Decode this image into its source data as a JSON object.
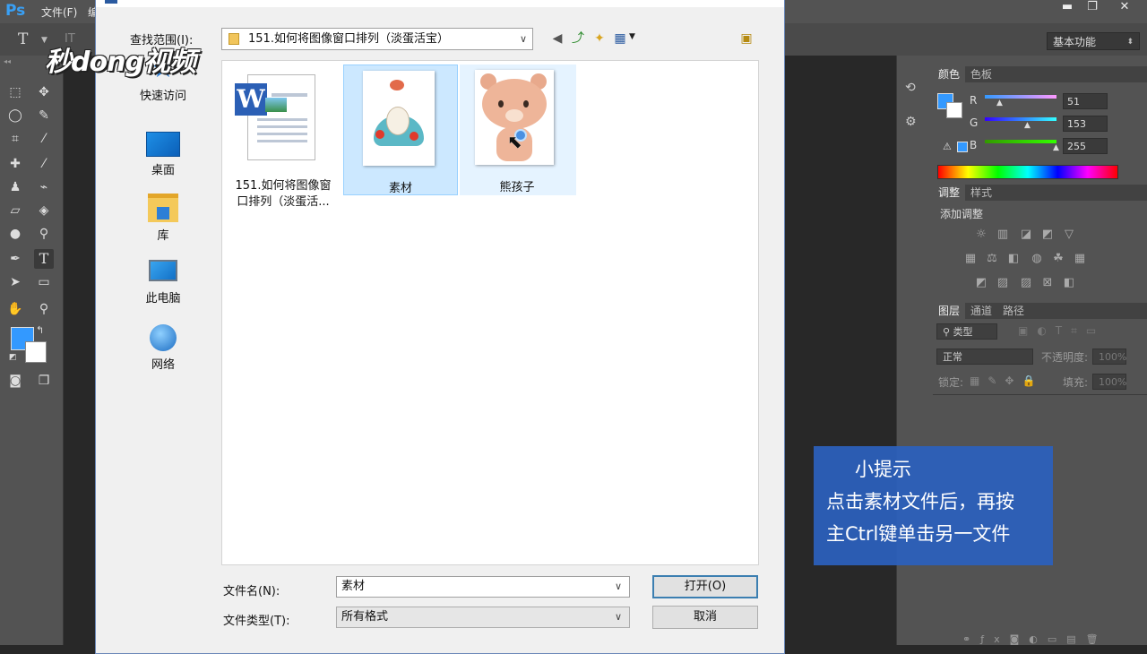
{
  "ps": {
    "logo": "Ps",
    "menu_file": "文件(F)",
    "menu_more": "编",
    "workspace": "基本功能",
    "color_panel": {
      "tabs": [
        "颜色",
        "色板"
      ],
      "r_label": "R",
      "g_label": "G",
      "b_label": "B",
      "r": "51",
      "g": "153",
      "b": "255",
      "fg_color": "#3399ff"
    },
    "adjust_panel": {
      "tabs": [
        "调整",
        "样式"
      ],
      "title": "添加调整"
    },
    "layers_panel": {
      "tabs": [
        "图层",
        "通道",
        "路径"
      ],
      "filter": "类型",
      "blend": "正常",
      "opacity_label": "不透明度:",
      "opacity_value": "100%",
      "lock_label": "锁定:",
      "fill_label": "填充:",
      "fill_value": "100%"
    }
  },
  "dialog": {
    "lookin_label": "查找范围(I):",
    "lookin_value": "151.如何将图像窗口排列（淡蛋活宝）",
    "places": [
      "快速访问",
      "桌面",
      "库",
      "此电脑",
      "网络"
    ],
    "files": [
      {
        "name_line1": "151.如何将图像窗",
        "name_line2": "口排列（淡蛋活...",
        "kind": "word-doc"
      },
      {
        "name": "素材",
        "kind": "image",
        "state": "selected"
      },
      {
        "name": "熊孩子",
        "kind": "image",
        "state": "hover"
      }
    ],
    "filename_label": "文件名(N):",
    "filename_value": "素材",
    "filetype_label": "文件类型(T):",
    "filetype_value": "所有格式",
    "open_button": "打开(O)",
    "cancel_button": "取消"
  },
  "tip": {
    "title": "小提示",
    "line1": "点击素材文件后，再按",
    "line2": "主Ctrl键单击另一文件"
  },
  "watermark": "秒dong视频"
}
